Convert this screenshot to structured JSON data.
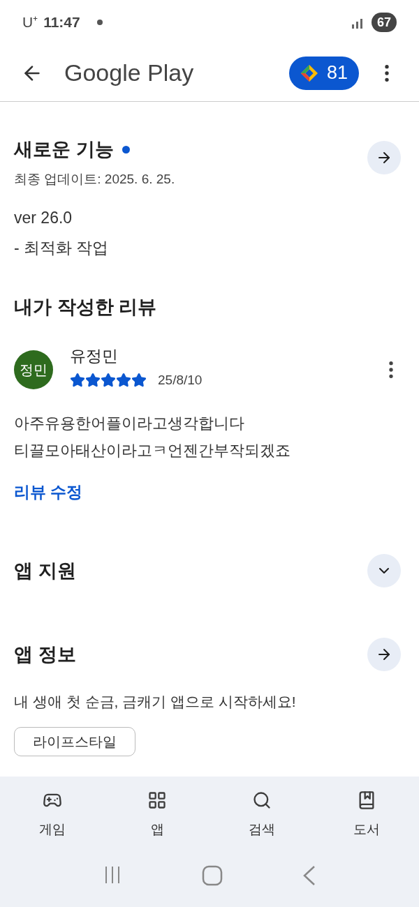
{
  "status_bar": {
    "carrier": "U⁺",
    "time": "11:47",
    "battery": "67"
  },
  "header": {
    "title": "Google Play",
    "points": "81"
  },
  "whats_new": {
    "title": "새로운 기능",
    "unread": true,
    "updated": "최종 업데이트: 2025. 6. 25.",
    "lines": [
      "ver 26.0",
      "- 최적화 작업"
    ]
  },
  "my_review": {
    "title": "내가 작성한 리뷰",
    "avatar": "정민",
    "author": "유정민",
    "stars": 5,
    "date": "25/8/10",
    "text": [
      "아주유용한어플이라고생각합니다",
      "티끌모아태산이라고ㅋ언젠간부작되겠죠"
    ],
    "edit": "리뷰 수정"
  },
  "sections": [
    {
      "title": "앱 지원",
      "kind": "expand"
    },
    {
      "title": "앱 정보",
      "kind": "link",
      "description": "내 생애 첫 순금, 금캐기 앱으로 시작하세요!"
    }
  ],
  "chip": "라이프스타일",
  "bottom_nav": [
    {
      "label": "게임",
      "kind": "games",
      "selected": false
    },
    {
      "label": "앱",
      "kind": "apps",
      "selected": false
    },
    {
      "label": "검색",
      "kind": "search",
      "selected": false
    },
    {
      "label": "도서",
      "kind": "books",
      "selected": false
    }
  ]
}
